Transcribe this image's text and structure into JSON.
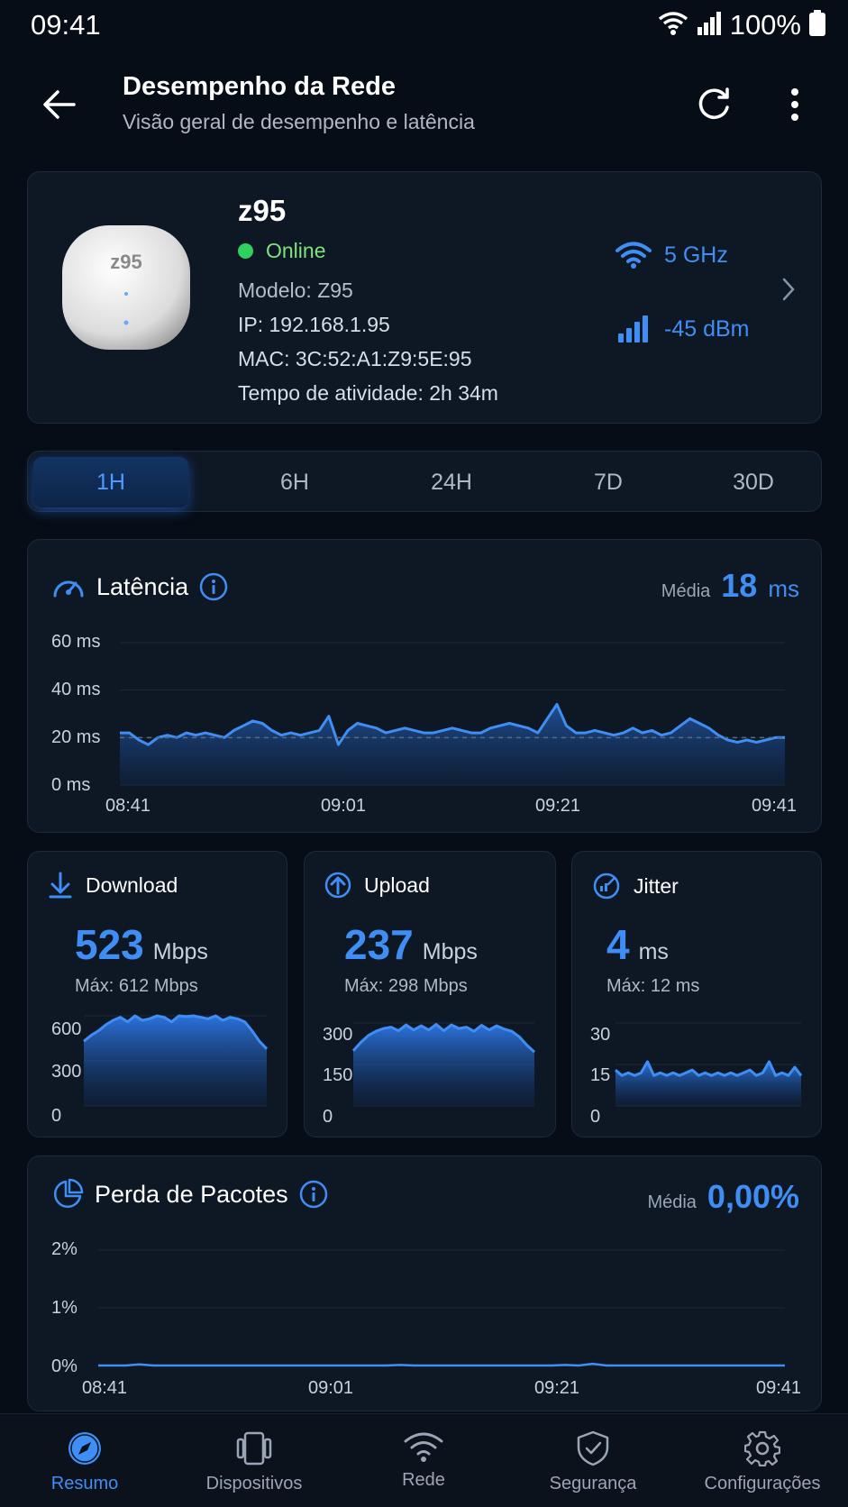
{
  "status_bar": {
    "time": "09:41",
    "battery": "100%"
  },
  "header": {
    "title": "Desempenho da Rede",
    "subtitle": "Visão geral de desempenho e latência"
  },
  "device": {
    "name": "z95",
    "badge": "z95",
    "status": "Online",
    "model": "Modelo: Z95",
    "ip": "IP: 192.168.1.95",
    "mac": "MAC: 3C:52:A1:Z9:5E:95",
    "uptime": "Tempo de atividade: 2h 34m",
    "band": "5 GHz",
    "signal": "-45 dBm"
  },
  "ranges": [
    "1H",
    "6H",
    "24H",
    "7D",
    "30D"
  ],
  "selected_range": "1H",
  "latency": {
    "title": "Latência",
    "avg_label": "Média",
    "avg_value": "18",
    "avg_unit": "ms",
    "y_labels": [
      "60 ms",
      "40 ms",
      "20 ms",
      "0 ms"
    ],
    "x_labels": [
      "08:41",
      "09:01",
      "09:21",
      "09:41"
    ]
  },
  "metrics": {
    "download": {
      "title": "Download",
      "value": "523",
      "unit": "Mbps",
      "max": "Máx: 612 Mbps",
      "y_labels": [
        "600",
        "300",
        "0"
      ]
    },
    "upload": {
      "title": "Upload",
      "value": "237",
      "unit": "Mbps",
      "max": "Máx: 298 Mbps",
      "y_labels": [
        "300",
        "150",
        "0"
      ]
    },
    "jitter": {
      "title": "Jitter",
      "value": "4",
      "unit": "ms",
      "max": "Máx: 12 ms",
      "y_labels": [
        "30",
        "15",
        "0"
      ]
    }
  },
  "packet_loss": {
    "title": "Perda de Pacotes",
    "avg_label": "Média",
    "avg_value": "0,00%",
    "y_labels": [
      "2%",
      "1%",
      "0%"
    ],
    "x_labels": [
      "08:41",
      "09:01",
      "09:21",
      "09:41"
    ]
  },
  "nav": {
    "items": [
      "Resumo",
      "Dispositivos",
      "Rede",
      "Segurança",
      "Configurações"
    ],
    "active": "Resumo"
  },
  "colors": {
    "accent": "#3f8ef5",
    "background": "#070d16",
    "card": "#0e1724",
    "online": "#2fd25d"
  },
  "chart_data": [
    {
      "type": "area",
      "title": "Latência",
      "ylabel": "ms",
      "ylim": [
        0,
        60
      ],
      "x_range": [
        "08:41",
        "09:41"
      ],
      "series": [
        {
          "values": [
            22,
            22,
            19,
            17,
            20,
            21,
            20,
            22,
            21,
            22,
            21,
            20,
            23,
            25,
            27,
            26,
            23,
            21,
            22,
            21,
            22,
            23,
            29,
            17,
            23,
            26,
            25,
            24,
            22,
            23,
            24,
            23,
            22,
            22,
            23,
            24,
            23,
            22,
            22,
            24,
            25,
            26,
            25,
            24,
            22,
            28,
            34,
            25,
            22,
            22,
            23,
            22,
            21,
            22,
            24,
            22,
            23,
            21,
            22,
            25,
            28,
            26,
            24,
            21,
            19,
            18,
            19,
            18,
            19,
            20,
            20
          ]
        }
      ]
    },
    {
      "type": "area",
      "title": "Download",
      "ylim": [
        0,
        600
      ],
      "series": [
        {
          "values": [
            430,
            470,
            500,
            540,
            570,
            590,
            560,
            600,
            570,
            580,
            600,
            590,
            560,
            600,
            595,
            600,
            590,
            580,
            600,
            570,
            590,
            580,
            560,
            500,
            430,
            380
          ]
        }
      ]
    },
    {
      "type": "area",
      "title": "Upload",
      "ylim": [
        0,
        300
      ],
      "series": [
        {
          "values": [
            200,
            230,
            255,
            270,
            280,
            285,
            272,
            293,
            275,
            290,
            275,
            295,
            272,
            293,
            280,
            285,
            270,
            292,
            275,
            290,
            278,
            270,
            250,
            220,
            195
          ]
        }
      ]
    },
    {
      "type": "area",
      "title": "Jitter",
      "ylim": [
        0,
        30
      ],
      "series": [
        {
          "values": [
            13,
            11,
            12,
            11,
            12,
            16,
            11,
            12,
            11,
            12,
            11,
            12,
            13,
            11,
            12,
            11,
            12,
            11,
            12,
            11,
            12,
            13,
            11,
            12,
            16,
            11,
            12,
            11,
            14,
            11
          ]
        }
      ]
    },
    {
      "type": "line",
      "title": "Perda de Pacotes",
      "ylim": [
        0,
        2
      ],
      "series": [
        {
          "values": [
            0,
            0,
            0,
            0.02,
            0,
            0,
            0,
            0,
            0,
            0,
            0,
            0,
            0,
            0,
            0,
            0,
            0,
            0,
            0,
            0,
            0,
            0,
            0.01,
            0,
            0,
            0,
            0,
            0,
            0,
            0,
            0,
            0,
            0,
            0,
            0.01,
            0,
            0.03,
            0,
            0,
            0,
            0,
            0,
            0,
            0,
            0,
            0,
            0,
            0,
            0,
            0,
            0
          ]
        }
      ]
    }
  ]
}
